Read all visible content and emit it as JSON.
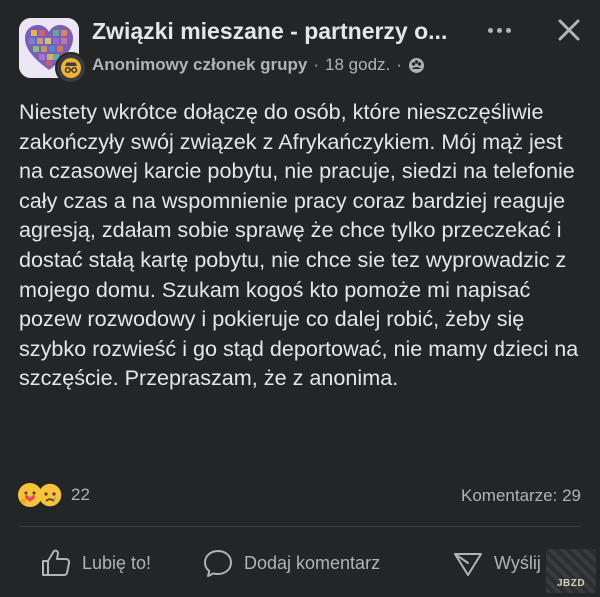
{
  "header": {
    "group_name": "Związki mieszane - partnerzy o...",
    "author": "Anonimowy członek grupy",
    "separator": "·",
    "time": "18 godz.",
    "separator2": "·",
    "privacy_icon": "group-members-icon",
    "more_icon": "more-horizontal-icon",
    "close_icon": "close-icon"
  },
  "post": {
    "text": "Niestety wkrótce dołączę do osób, które nieszczęśliwie zakończyły swój związek z Afrykańczykiem. Mój mąż jest na czasowej karcie pobytu, nie pracuje, siedzi na telefonie cały czas a na wspomnienie pracy coraz bardziej reaguje agresją, zdałam sobie sprawę że chce tylko przeczekać i dostać stałą kartę pobytu, nie chce sie tez wyprowadzic z mojego domu. Szukam kogoś kto pomoże mi napisać pozew rozwodowy i pokieruje co dalej robić, żeby się szybko rozwieść i go stąd deportować, nie mamy dzieci na szczęście. Przepraszam, że z anonima."
  },
  "stats": {
    "reactions": [
      "care-emoji",
      "sad-emoji"
    ],
    "reaction_count": "22",
    "comments": "Komentarze: 29"
  },
  "actions": {
    "like_label": "Lubię to!",
    "comment_label": "Dodaj komentarz",
    "share_label": "Wyślij"
  },
  "watermark": {
    "text": "JBZD"
  },
  "colors": {
    "background": "#242526",
    "text": "#e4e6eb",
    "secondary_text": "#b0b3b8",
    "divider": "#3e4042",
    "badge": "#f2b233"
  }
}
